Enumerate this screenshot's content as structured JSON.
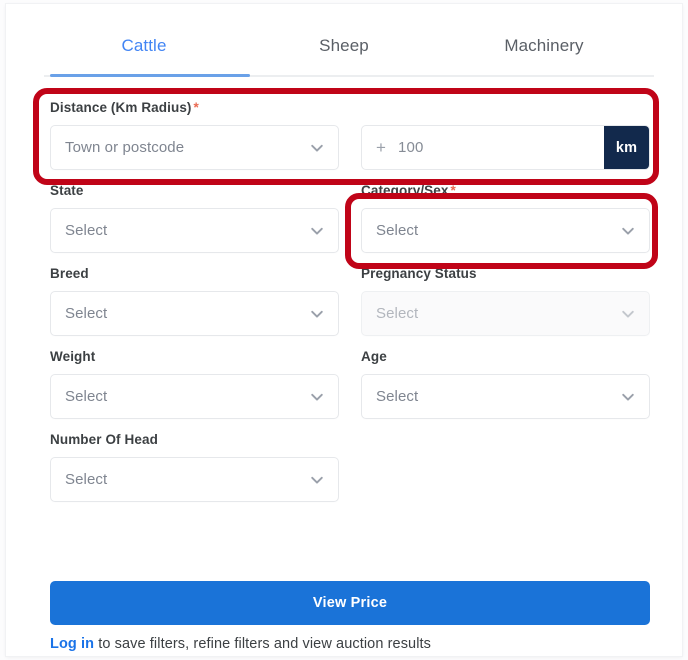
{
  "tabs": [
    {
      "label": "Cattle",
      "active": true
    },
    {
      "label": "Sheep",
      "active": false
    },
    {
      "label": "Machinery",
      "active": false
    }
  ],
  "form": {
    "distance": {
      "label": "Distance (Km Radius)",
      "required_marker": "*",
      "location_placeholder": "Town or postcode",
      "plus_symbol": "+",
      "radius_value": "100",
      "unit_label": "km"
    },
    "state": {
      "label": "State",
      "placeholder": "Select"
    },
    "category_sex": {
      "label": "Category/Sex",
      "required_marker": "*",
      "placeholder": "Select"
    },
    "breed": {
      "label": "Breed",
      "placeholder": "Select"
    },
    "pregnancy_status": {
      "label": "Pregnancy Status",
      "placeholder": "Select"
    },
    "weight": {
      "label": "Weight",
      "placeholder": "Select"
    },
    "age": {
      "label": "Age",
      "placeholder": "Select"
    },
    "number_of_head": {
      "label": "Number Of Head",
      "placeholder": "Select"
    }
  },
  "actions": {
    "view_price": "View Price"
  },
  "footer": {
    "login_link": "Log in",
    "login_rest": " to save filters, refine filters and view auction results"
  },
  "colors": {
    "active_tab": "#4285f4",
    "inactive_tab": "#5a5f66",
    "primary_button": "#1a73d8",
    "link": "#1a73e8",
    "required_asterisk": "#ea6a52",
    "km_badge": "#12294c",
    "annotation_outline": "#c00418",
    "field_border": "#e6e8eb",
    "placeholder_text": "#7f8590",
    "disabled_field_bg": "#fafafb"
  },
  "icons": {
    "chevron_down": "chevron-down-icon",
    "plus": "plus-icon"
  }
}
